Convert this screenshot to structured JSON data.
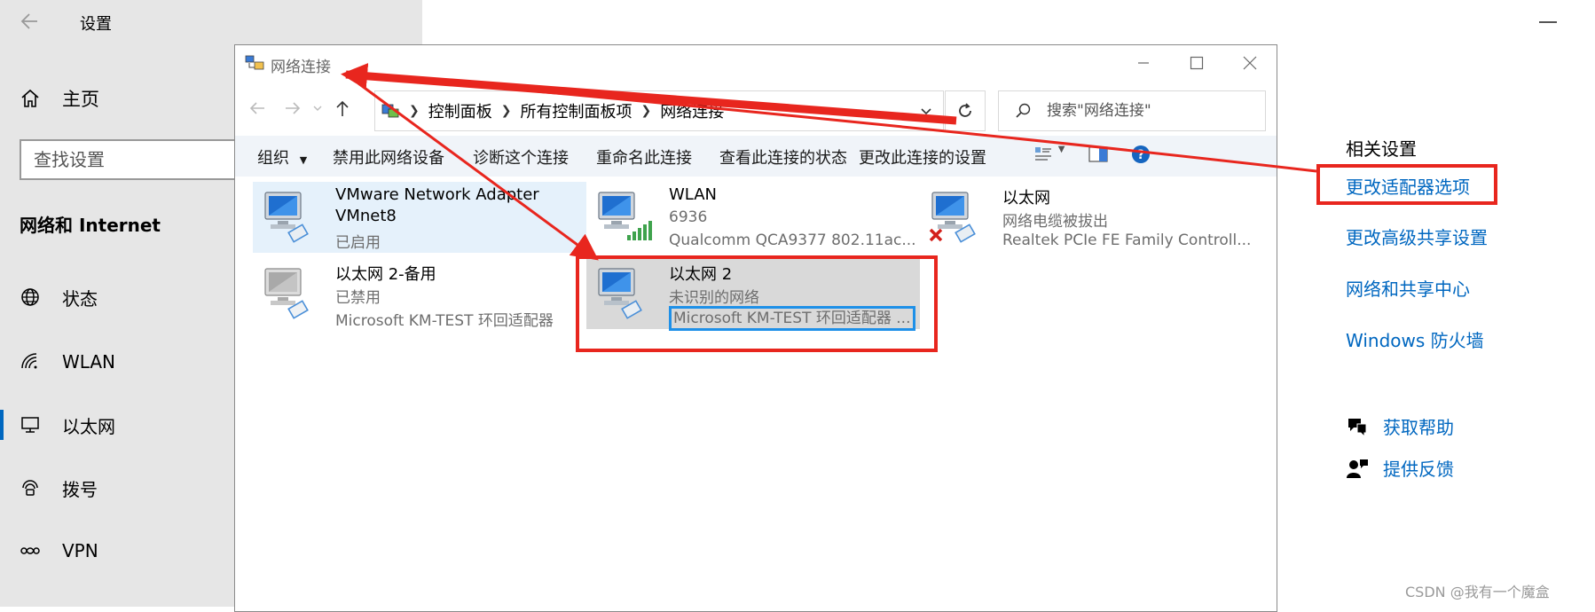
{
  "settings": {
    "title": "设置",
    "home": "主页",
    "search_placeholder": "查找设置",
    "section": "网络和 Internet",
    "nav": [
      {
        "label": "状态",
        "icon": "globe-icon"
      },
      {
        "label": "WLAN",
        "icon": "wifi-icon"
      },
      {
        "label": "以太网",
        "icon": "ethernet-icon",
        "selected": true
      },
      {
        "label": "拨号",
        "icon": "dialup-icon"
      },
      {
        "label": "VPN",
        "icon": "vpn-icon"
      }
    ]
  },
  "related": {
    "heading": "相关设置",
    "links": [
      "更改适配器选项",
      "更改高级共享设置",
      "网络和共享中心",
      "Windows 防火墙"
    ],
    "help": "获取帮助",
    "feedback": "提供反馈"
  },
  "net_window": {
    "title": "网络连接",
    "breadcrumb": [
      "控制面板",
      "所有控制面板项",
      "网络连接"
    ],
    "search_placeholder": "搜索\"网络连接\"",
    "toolbar": {
      "organize": "组织",
      "disable": "禁用此网络设备",
      "diagnose": "诊断这个连接",
      "rename": "重命名此连接",
      "status": "查看此连接的状态",
      "change": "更改此连接的设置"
    },
    "connections": [
      {
        "name": "VMware Network Adapter",
        "name2": "VMnet8",
        "line3": "已启用"
      },
      {
        "name": "WLAN",
        "line2": "6936",
        "line3": "Qualcomm QCA9377 802.11ac..."
      },
      {
        "name": "以太网",
        "line2": "网络电缆被拔出",
        "line3": "Realtek PCIe FE Family Controll..."
      },
      {
        "name": "以太网 2-备用",
        "line2": "已禁用",
        "line3": "Microsoft KM-TEST 环回适配器"
      },
      {
        "name": "以太网 2",
        "line2": "未识别的网络",
        "line3": "Microsoft KM-TEST 环回适配器 ..."
      }
    ]
  },
  "watermark": "CSDN @我有一个魔盒",
  "colors": {
    "accent": "#0067c0",
    "annotation_red": "#e8261e",
    "selection_blue": "#1e90e8",
    "pane_gray": "#e6e6e6"
  }
}
